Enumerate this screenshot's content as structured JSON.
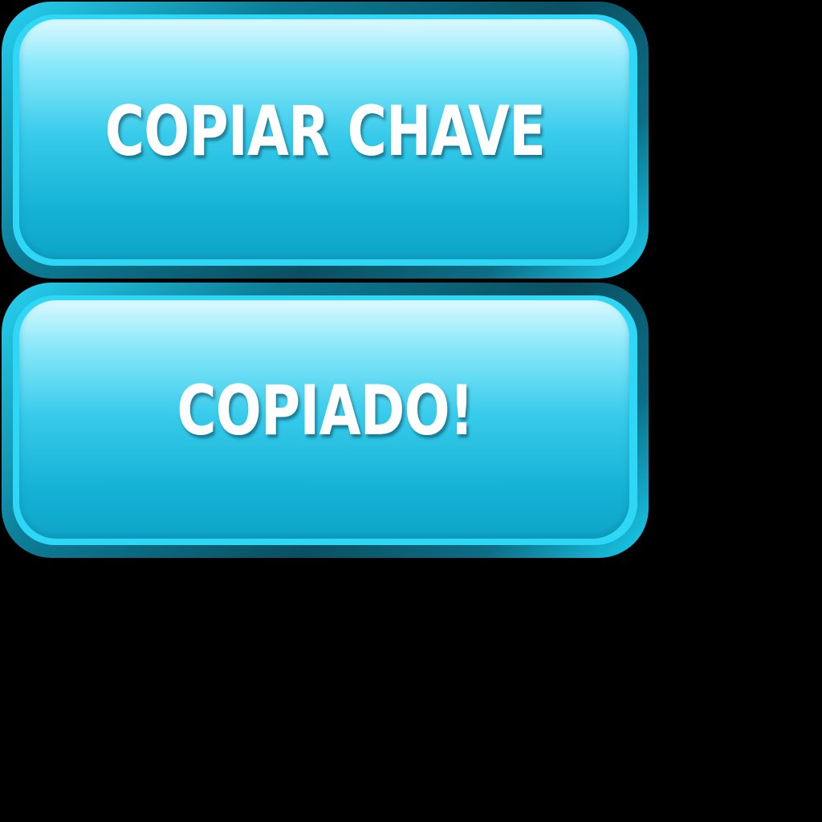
{
  "buttons": [
    {
      "label": "COPIAR CHAVE"
    },
    {
      "label": "COPIADO!"
    }
  ],
  "colors": {
    "background": "#000000",
    "button_face_top": "#dcf9ff",
    "button_face_bottom": "#0fa6c9",
    "button_rim": "#2fd7f7",
    "button_shadow": "#0a4f61",
    "label_text": "#ffffff"
  }
}
